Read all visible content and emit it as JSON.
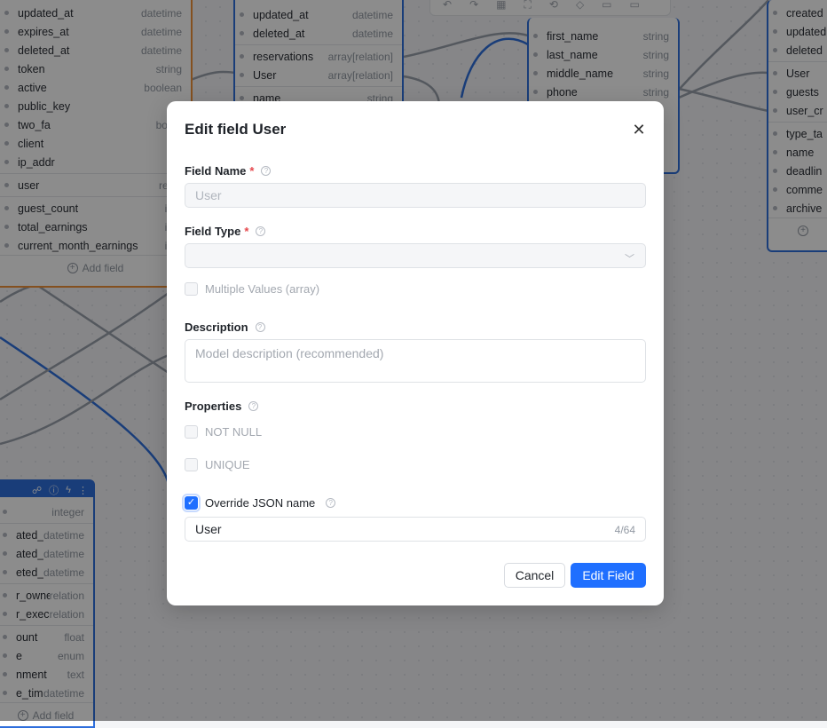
{
  "tables": {
    "left_top": {
      "rows": [
        {
          "name": "updated_at",
          "type": "datetime"
        },
        {
          "name": "expires_at",
          "type": "datetime"
        },
        {
          "name": "deleted_at",
          "type": "datetime"
        },
        {
          "name": "token",
          "type": "string"
        },
        {
          "name": "active",
          "type": "boolean"
        },
        {
          "name": "public_key",
          "type": "str"
        },
        {
          "name": "two_fa",
          "type": "boole"
        },
        {
          "name": "client",
          "type": "str"
        },
        {
          "name": "ip_addr",
          "type": "str"
        },
        {
          "name": "user",
          "type": "relati"
        },
        {
          "name": "guest_count",
          "type": "inte"
        },
        {
          "name": "total_earnings",
          "type": "inte"
        },
        {
          "name": "current_month_earnings",
          "type": "inte"
        }
      ],
      "add_label": "Add field"
    },
    "mid_top": {
      "rows": [
        {
          "name": "updated_at",
          "type": "datetime"
        },
        {
          "name": "deleted_at",
          "type": "datetime"
        },
        {
          "name": "reservations",
          "type": "array[relation]"
        },
        {
          "name": "User",
          "type": "array[relation]"
        },
        {
          "name": "name",
          "type": "string"
        }
      ]
    },
    "right_mid": {
      "rows": [
        {
          "name": "first_name",
          "type": "string"
        },
        {
          "name": "last_name",
          "type": "string"
        },
        {
          "name": "middle_name",
          "type": "string"
        },
        {
          "name": "phone",
          "type": "string"
        }
      ]
    },
    "far_right": {
      "rows": [
        {
          "name": "created"
        },
        {
          "name": "updated"
        },
        {
          "name": "deleted"
        },
        {
          "name": "User"
        },
        {
          "name": "guests"
        },
        {
          "name": "user_cr"
        },
        {
          "name": "type_ta"
        },
        {
          "name": "name"
        },
        {
          "name": "deadlin"
        },
        {
          "name": "comme"
        },
        {
          "name": "archive"
        }
      ]
    },
    "left_bottom": {
      "rows": [
        {
          "name": "",
          "type": "integer"
        },
        {
          "name": "ated_at",
          "type": "datetime"
        },
        {
          "name": "ated_at",
          "type": "datetime"
        },
        {
          "name": "eted_at",
          "type": "datetime"
        },
        {
          "name": "r_owner",
          "type": "relation"
        },
        {
          "name": "r_exec",
          "type": "relation"
        },
        {
          "name": "ount",
          "type": "float"
        },
        {
          "name": "e",
          "type": "enum"
        },
        {
          "name": "nment",
          "type": "text"
        },
        {
          "name": "e_time",
          "type": "datetime"
        }
      ],
      "add_label": "Add field"
    }
  },
  "modal": {
    "title": "Edit field User",
    "field_name_label": "Field Name",
    "field_name_placeholder": "User",
    "field_type_label": "Field Type",
    "field_type_value": "",
    "multiple_values_label": "Multiple Values (array)",
    "description_label": "Description",
    "description_placeholder": "Model description (recommended)",
    "properties_label": "Properties",
    "not_null_label": "NOT NULL",
    "unique_label": "UNIQUE",
    "override_json_label": "Override JSON name",
    "override_json_checked": true,
    "json_name_value": "User",
    "json_name_counter": "4/64",
    "cancel_label": "Cancel",
    "submit_label": "Edit Field",
    "required_mark": "*",
    "help_glyph": "?"
  },
  "colors": {
    "accent": "#1f6fff",
    "table_border": "#2f6fdc",
    "table_border_alt": "#f0933a",
    "required": "#e5484d"
  }
}
